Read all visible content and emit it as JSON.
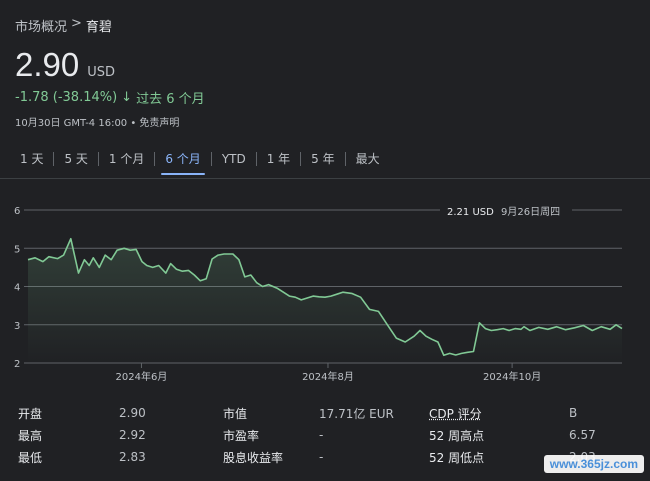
{
  "breadcrumb": {
    "root": "市场概况",
    "separator": ">",
    "current": "育碧"
  },
  "quote": {
    "price": "2.90",
    "currency": "USD",
    "change": "-1.78 (-38.14%)",
    "change_arrow": "↓",
    "change_period": "过去 6 个月",
    "timestamp": "10月30日 GMT-4 16:00 • 免责声明",
    "color_positive": "#81c995"
  },
  "tabs": [
    {
      "label": "1 天",
      "active": false
    },
    {
      "label": "5 天",
      "active": false
    },
    {
      "label": "1 个月",
      "active": false
    },
    {
      "label": "6 个月",
      "active": true
    },
    {
      "label": "YTD",
      "active": false
    },
    {
      "label": "1 年",
      "active": false
    },
    {
      "label": "5 年",
      "active": false
    },
    {
      "label": "最大",
      "active": false
    }
  ],
  "chart_data": {
    "type": "area",
    "y_ticks": [
      "2",
      "3",
      "4",
      "5",
      "6"
    ],
    "ylim": [
      2,
      6
    ],
    "x_ticks": [
      "2024年6月",
      "2024年8月",
      "2024年10月"
    ],
    "x_tick_positions": [
      0.191,
      0.505,
      0.815
    ],
    "grid": true,
    "tooltip": {
      "value": "2.21 USD",
      "date": "9月26日周四"
    },
    "line_color": "#81c995",
    "series": [
      {
        "x": [
          0.0,
          0.012,
          0.025,
          0.035,
          0.05,
          0.06,
          0.072,
          0.085,
          0.095,
          0.103,
          0.11,
          0.12,
          0.13,
          0.14,
          0.15,
          0.162,
          0.172,
          0.182,
          0.192,
          0.2,
          0.21,
          0.22,
          0.232,
          0.24,
          0.25,
          0.26,
          0.27,
          0.28,
          0.29,
          0.3,
          0.31,
          0.32,
          0.33,
          0.345,
          0.355,
          0.365,
          0.375,
          0.385,
          0.395,
          0.405,
          0.42,
          0.43,
          0.44,
          0.45,
          0.46,
          0.47,
          0.48,
          0.49,
          0.5,
          0.51,
          0.52,
          0.53,
          0.545,
          0.56,
          0.575,
          0.59,
          0.605,
          0.62,
          0.635,
          0.65,
          0.66,
          0.67,
          0.68,
          0.69,
          0.7,
          0.71,
          0.72,
          0.73,
          0.74,
          0.75,
          0.76,
          0.77,
          0.78,
          0.79,
          0.8,
          0.81,
          0.82,
          0.83,
          0.835,
          0.845,
          0.86,
          0.875,
          0.89,
          0.905,
          0.92,
          0.935,
          0.95,
          0.965,
          0.98,
          0.99,
          1.0
        ],
        "values": [
          4.7,
          4.75,
          4.65,
          4.78,
          4.73,
          4.82,
          5.25,
          4.35,
          4.7,
          4.55,
          4.75,
          4.5,
          4.82,
          4.7,
          4.95,
          5.0,
          4.95,
          4.97,
          4.65,
          4.55,
          4.5,
          4.55,
          4.35,
          4.6,
          4.45,
          4.4,
          4.42,
          4.3,
          4.15,
          4.2,
          4.72,
          4.82,
          4.85,
          4.85,
          4.7,
          4.25,
          4.3,
          4.1,
          4.0,
          4.05,
          3.95,
          3.85,
          3.75,
          3.72,
          3.65,
          3.7,
          3.75,
          3.73,
          3.72,
          3.75,
          3.8,
          3.85,
          3.82,
          3.72,
          3.4,
          3.35,
          3.0,
          2.65,
          2.55,
          2.7,
          2.85,
          2.7,
          2.62,
          2.55,
          2.2,
          2.25,
          2.21,
          2.25,
          2.28,
          2.3,
          3.05,
          2.9,
          2.85,
          2.87,
          2.9,
          2.85,
          2.9,
          2.88,
          2.95,
          2.85,
          2.93,
          2.88,
          2.95,
          2.87,
          2.92,
          2.98,
          2.85,
          2.95,
          2.88,
          3.0,
          2.9
        ]
      }
    ]
  },
  "stats": [
    {
      "l1": "开盘",
      "v1": "2.90",
      "l2": "市值",
      "v2": "17.71亿 EUR",
      "l3": "CDP 评分",
      "v3": "B"
    },
    {
      "l1": "最高",
      "v1": "2.92",
      "l2": "市盈率",
      "v2": "-",
      "l3": "52 周高点",
      "v3": "6.57"
    },
    {
      "l1": "最低",
      "v1": "2.83",
      "l2": "股息收益率",
      "v2": "-",
      "l3": "52 周低点",
      "v3": "2.03"
    }
  ],
  "watermark": "www.365jz.com"
}
